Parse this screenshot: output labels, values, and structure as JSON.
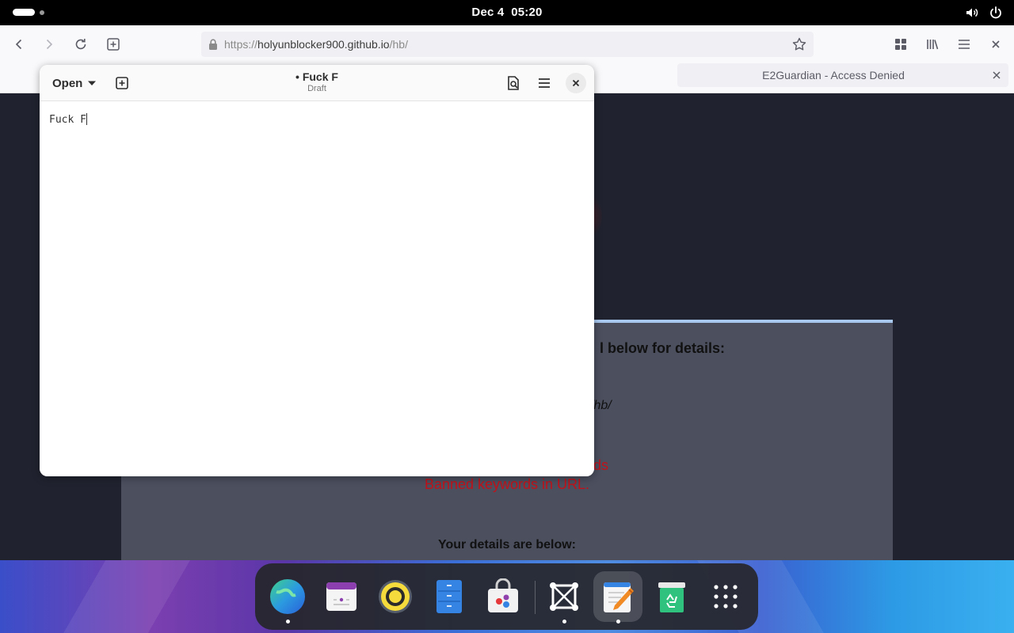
{
  "topbar": {
    "date": "Dec 4",
    "time": "05:20"
  },
  "browser": {
    "url_scheme": "https://",
    "url_host": "holyunblocker900.github.io",
    "url_path": "/hb/",
    "tab_title": "E2Guardian - Access Denied",
    "page": {
      "heading_fragment": "l below for details:",
      "url_fragment": "/hb/",
      "category_fragment": "rds",
      "reason": "Banned keywords in URL.",
      "details_heading": "Your details are below:"
    }
  },
  "editor": {
    "open_label": "Open",
    "title": "Fuck F",
    "modified_marker": "•",
    "subtitle": "Draft",
    "content": "Fuck F"
  },
  "dock": {
    "items": [
      "web-browser",
      "calendar",
      "rhythmbox",
      "files",
      "software",
      "screenshot",
      "text-editor",
      "recycle-bin",
      "show-apps"
    ]
  }
}
